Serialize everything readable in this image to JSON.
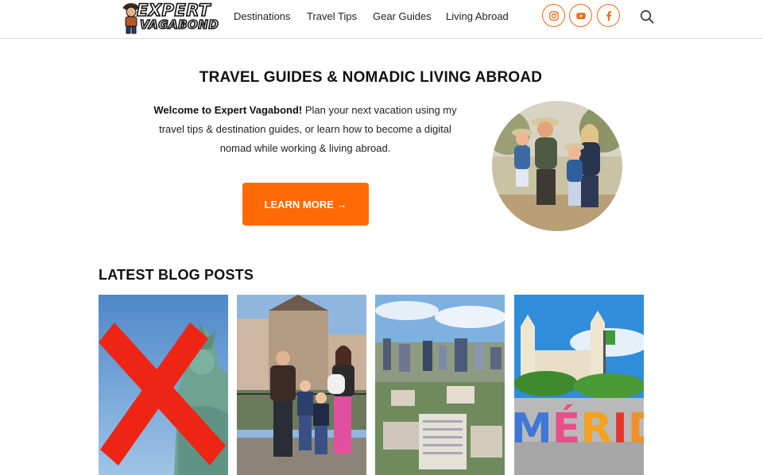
{
  "header": {
    "logo": {
      "line1": "EXPERT",
      "line2": "VAGABOND"
    },
    "nav": [
      "Destinations",
      "Travel Tips",
      "Gear Guides",
      "Living Abroad"
    ],
    "social": [
      {
        "name": "instagram-icon"
      },
      {
        "name": "youtube-icon"
      },
      {
        "name": "facebook-icon"
      }
    ],
    "search_icon": "search-icon",
    "accent_color": "#f26a1b"
  },
  "hero": {
    "title": "TRAVEL GUIDES & NOMADIC LIVING ABROAD",
    "intro_bold": "Welcome to Expert Vagabond!",
    "intro_rest": " Plan your next vacation using my travel tips & destination guides, or learn how to become a digital nomad while working & living abroad.",
    "cta_label": "LEARN MORE →",
    "cta_color": "#ff6a07"
  },
  "latest": {
    "title": "LATEST BLOG POSTS",
    "posts": [
      {
        "name": "post-statue-of-liberty"
      },
      {
        "name": "post-family-castle"
      },
      {
        "name": "post-city-skyline"
      },
      {
        "name": "post-merida-sign",
        "sign_text": "MÉRIDA"
      }
    ]
  }
}
